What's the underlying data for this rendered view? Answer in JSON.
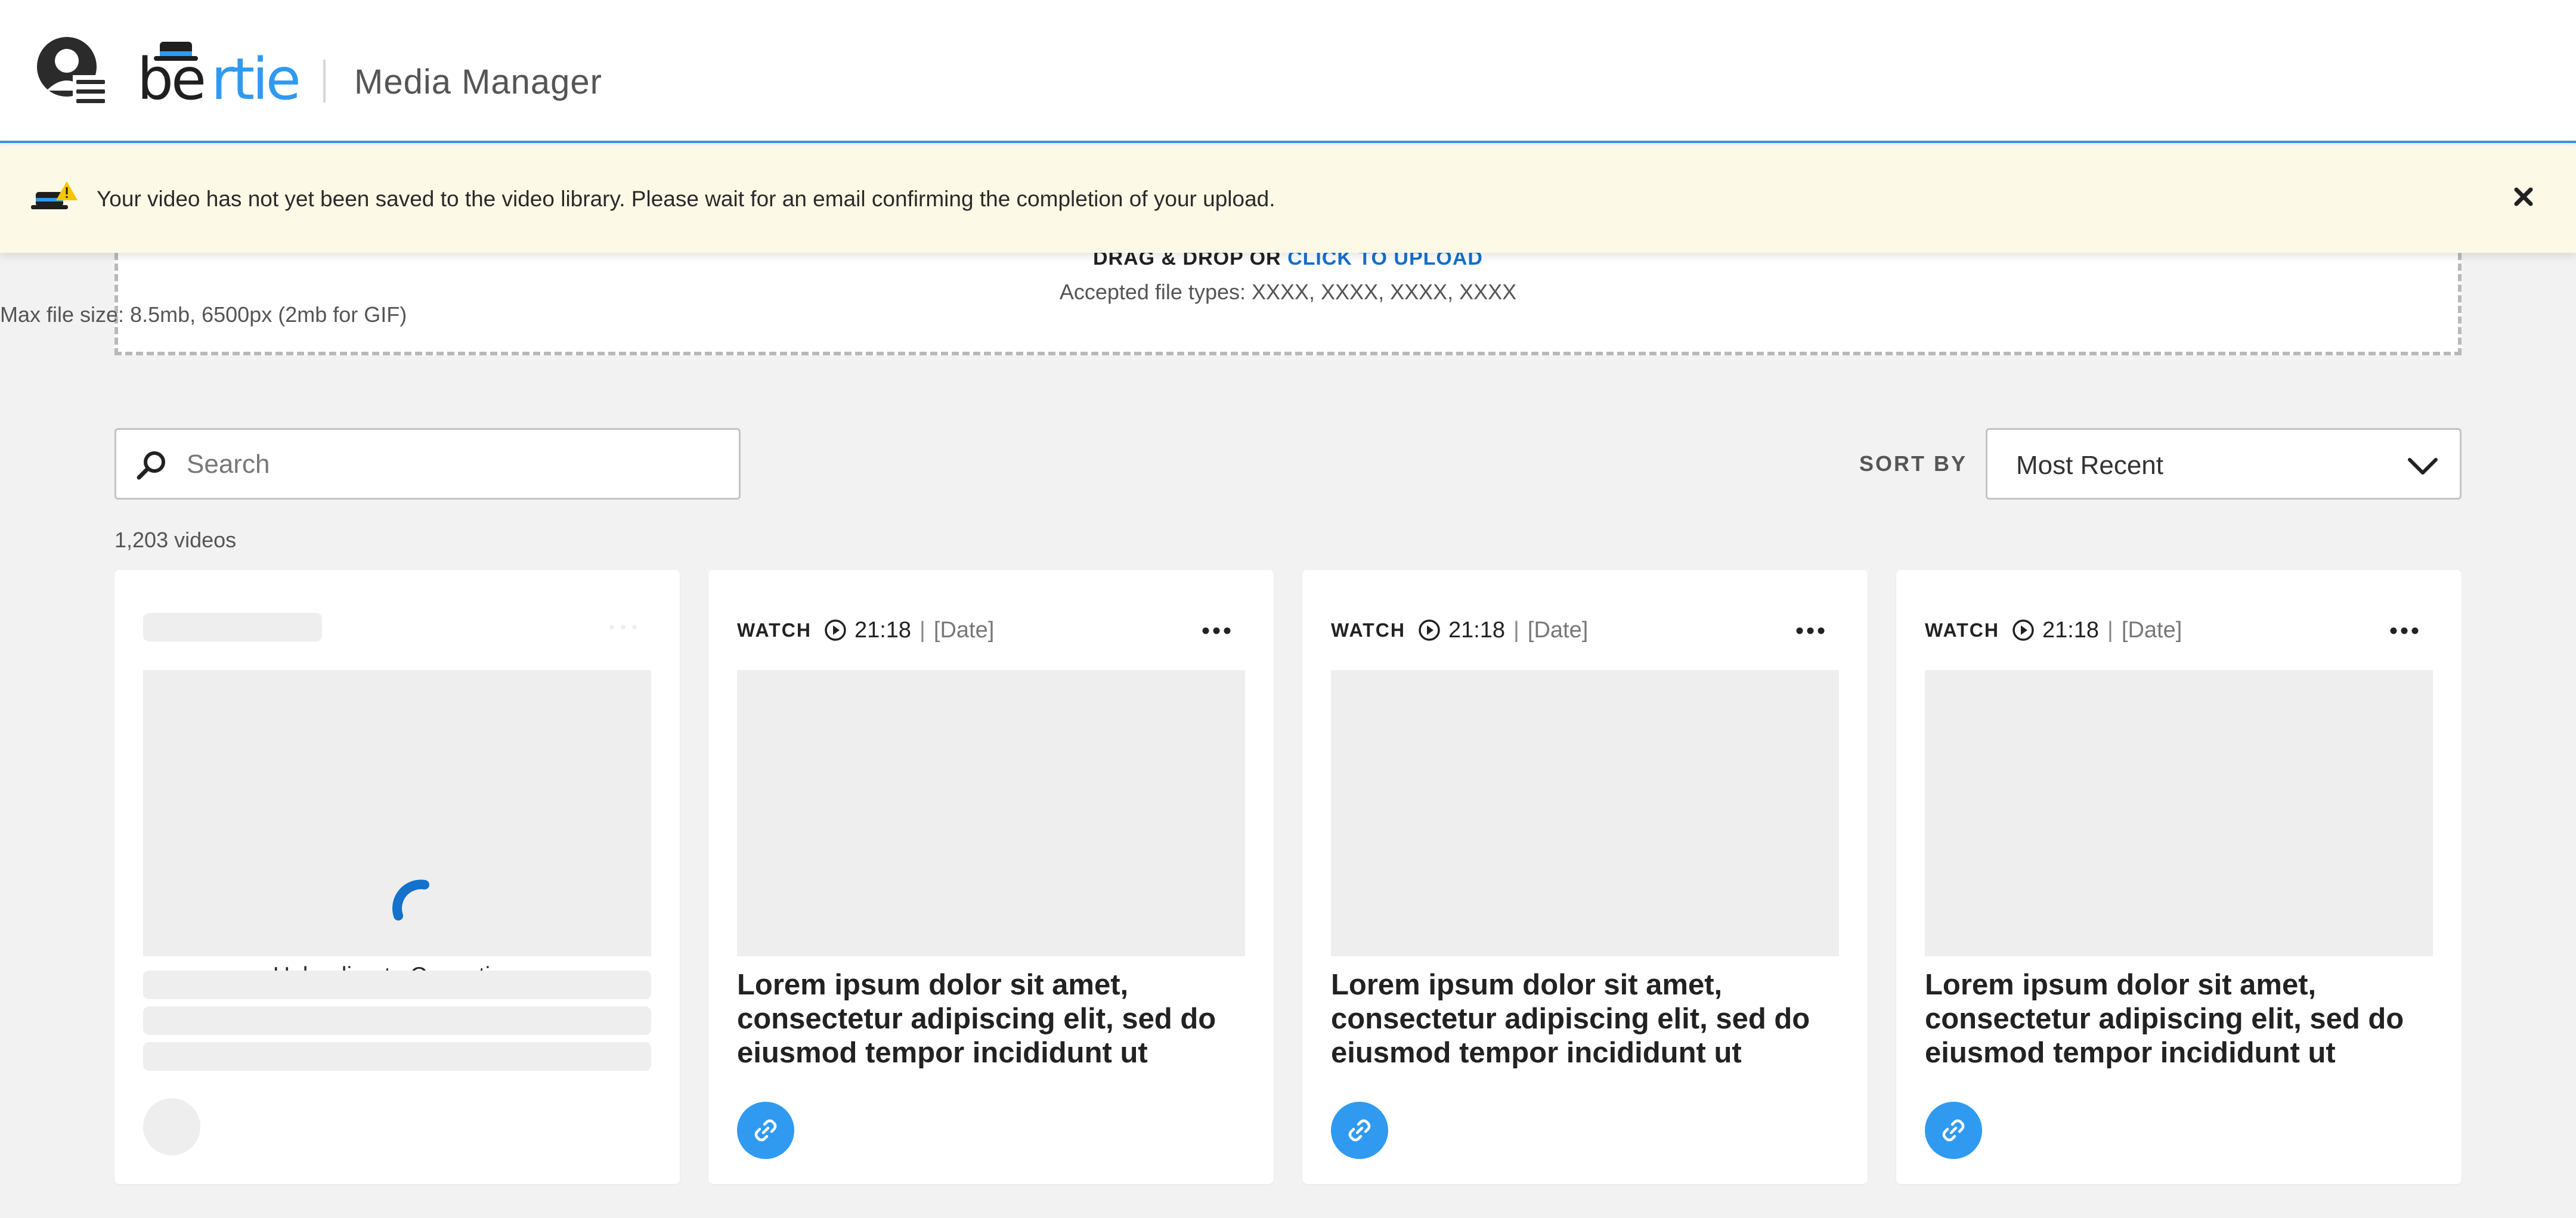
{
  "header": {
    "logo_text": "bertie",
    "app_title": "Media Manager",
    "menu_icon": "hamburger-menu-icon",
    "avatar_icon": "user-avatar-icon"
  },
  "banner": {
    "message": "Your video has not yet been saved to the video library. Please wait for an email confirming the completion of your upload.",
    "icon": "bertie-hat-warning-icon",
    "close_icon": "close-icon",
    "background": "#fcf9e6"
  },
  "upload": {
    "prompt": "DRAG & DROP OR ",
    "link": "CLICK TO UPLOAD",
    "accepted_types": "Accepted file types: XXXX, XXXX, XXXX, XXXX",
    "max_size": "Max file size: 8.5mb, 6500px  (2mb for GIF)"
  },
  "search": {
    "placeholder": "Search",
    "value": ""
  },
  "sort": {
    "label": "SORT BY",
    "selected": "Most Recent"
  },
  "video_count": "1,203 videos",
  "uploading_card": {
    "status": "Uploading to Connatix..."
  },
  "cards": [
    {
      "watch_label": "WATCH",
      "duration": "21:18",
      "separator": "|",
      "date": "[Date]",
      "title": "Lorem ipsum dolor sit amet, consectetur adipiscing elit, sed do eiusmod tempor incididunt ut"
    },
    {
      "watch_label": "WATCH",
      "duration": "21:18",
      "separator": "|",
      "date": "[Date]",
      "title": "Lorem ipsum dolor sit amet, consectetur adipiscing elit, sed do eiusmod tempor incididunt ut"
    },
    {
      "watch_label": "WATCH",
      "duration": "21:18",
      "separator": "|",
      "date": "[Date]",
      "title": "Lorem ipsum dolor sit amet, consectetur adipiscing elit, sed do eiusmod tempor incididunt ut"
    }
  ],
  "colors": {
    "accent": "#1471cc",
    "link_button": "#2f9af0",
    "header_border": "#3d93e0"
  }
}
